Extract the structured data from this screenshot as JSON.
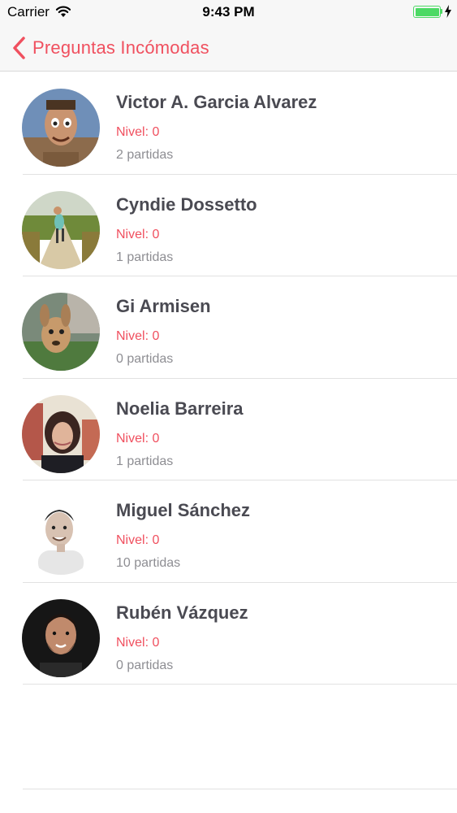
{
  "status_bar": {
    "carrier": "Carrier",
    "time": "9:43 PM"
  },
  "nav": {
    "back_label": "Preguntas Incómodas",
    "accent_color": "#f0505f"
  },
  "players": [
    {
      "name": "Victor A. Garcia Alvarez",
      "level": "Nivel: 0",
      "games": "2 partidas",
      "avatar": "cartoon-character-avatar"
    },
    {
      "name": "Cyndie Dossetto",
      "level": "Nivel: 0",
      "games": "1 partidas",
      "avatar": "road-landscape-avatar"
    },
    {
      "name": "Gi Armisen",
      "level": "Nivel: 0",
      "games": "0 partidas",
      "avatar": "deer-avatar"
    },
    {
      "name": "Noelia Barreira",
      "level": "Nivel: 0",
      "games": "1 partidas",
      "avatar": "woman-portrait-avatar"
    },
    {
      "name": "Miguel Sánchez",
      "level": "Nivel: 0",
      "games": "10 partidas",
      "avatar": "man-portrait-avatar"
    },
    {
      "name": "Rubén Vázquez",
      "level": "Nivel: 0",
      "games": "0 partidas",
      "avatar": "bearded-man-avatar"
    }
  ]
}
